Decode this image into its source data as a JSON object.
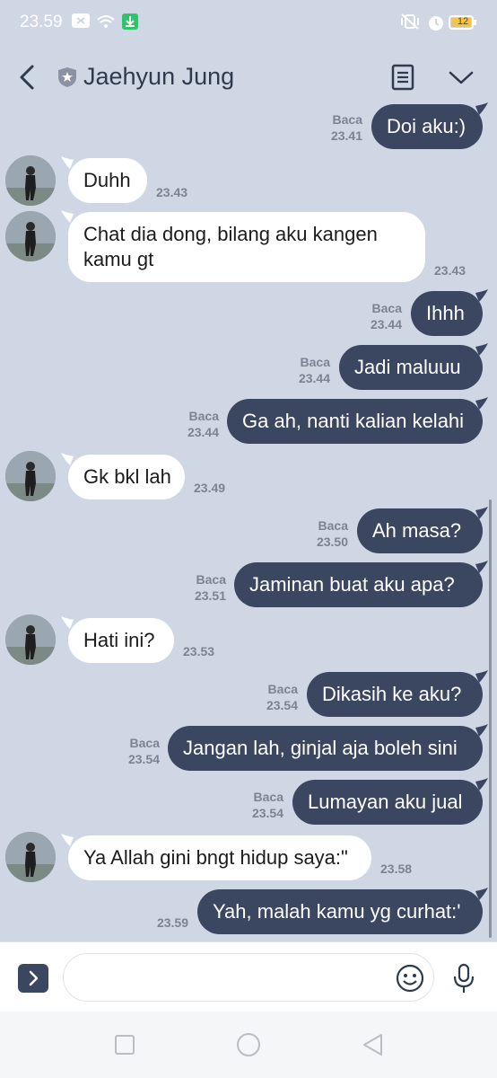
{
  "status_bar": {
    "time": "23.59",
    "battery": "12"
  },
  "header": {
    "title": "Jaehyun Jung"
  },
  "messages": [
    {
      "dir": "out",
      "text": "Doi aku:)",
      "read": "Baca",
      "time": "23.41"
    },
    {
      "dir": "in",
      "text": "Duhh",
      "time": "23.43"
    },
    {
      "dir": "in",
      "line1": "Chat dia dong, bilang aku kangen",
      "line2": "kamu gt",
      "time": "23.43"
    },
    {
      "dir": "out",
      "text": "Ihhh",
      "read": "Baca",
      "time": "23.44"
    },
    {
      "dir": "out",
      "text": "Jadi maluuu",
      "read": "Baca",
      "time": "23.44"
    },
    {
      "dir": "out",
      "text": "Ga ah, nanti kalian kelahi",
      "read": "Baca",
      "time": "23.44"
    },
    {
      "dir": "in",
      "text": "Gk bkl lah",
      "time": "23.49"
    },
    {
      "dir": "out",
      "text": "Ah masa?",
      "read": "Baca",
      "time": "23.50"
    },
    {
      "dir": "out",
      "text": "Jaminan buat aku apa?",
      "read": "Baca",
      "time": "23.51"
    },
    {
      "dir": "in",
      "text": "Hati ini?",
      "time": "23.53"
    },
    {
      "dir": "out",
      "text": "Dikasih ke aku?",
      "read": "Baca",
      "time": "23.54"
    },
    {
      "dir": "out",
      "text": "Jangan lah, ginjal aja boleh sini",
      "read": "Baca",
      "time": "23.54"
    },
    {
      "dir": "out",
      "text": "Lumayan aku jual",
      "read": "Baca",
      "time": "23.54"
    },
    {
      "dir": "in",
      "text": "Ya Allah gini bngt hidup saya:\"",
      "time": "23.58"
    },
    {
      "dir": "out",
      "text": "Yah, malah kamu yg curhat:'",
      "time": "23.59"
    }
  ],
  "input": {
    "value": ""
  },
  "colors": {
    "background": "#cfd7e4",
    "outgoing_bubble": "#3b4660",
    "incoming_bubble": "#ffffff",
    "meta_text": "#7b8494"
  },
  "icons": [
    "back-arrow",
    "shield",
    "notes",
    "chevron-down",
    "expand",
    "emoji",
    "microphone",
    "nav-square",
    "nav-circle",
    "nav-triangle"
  ]
}
